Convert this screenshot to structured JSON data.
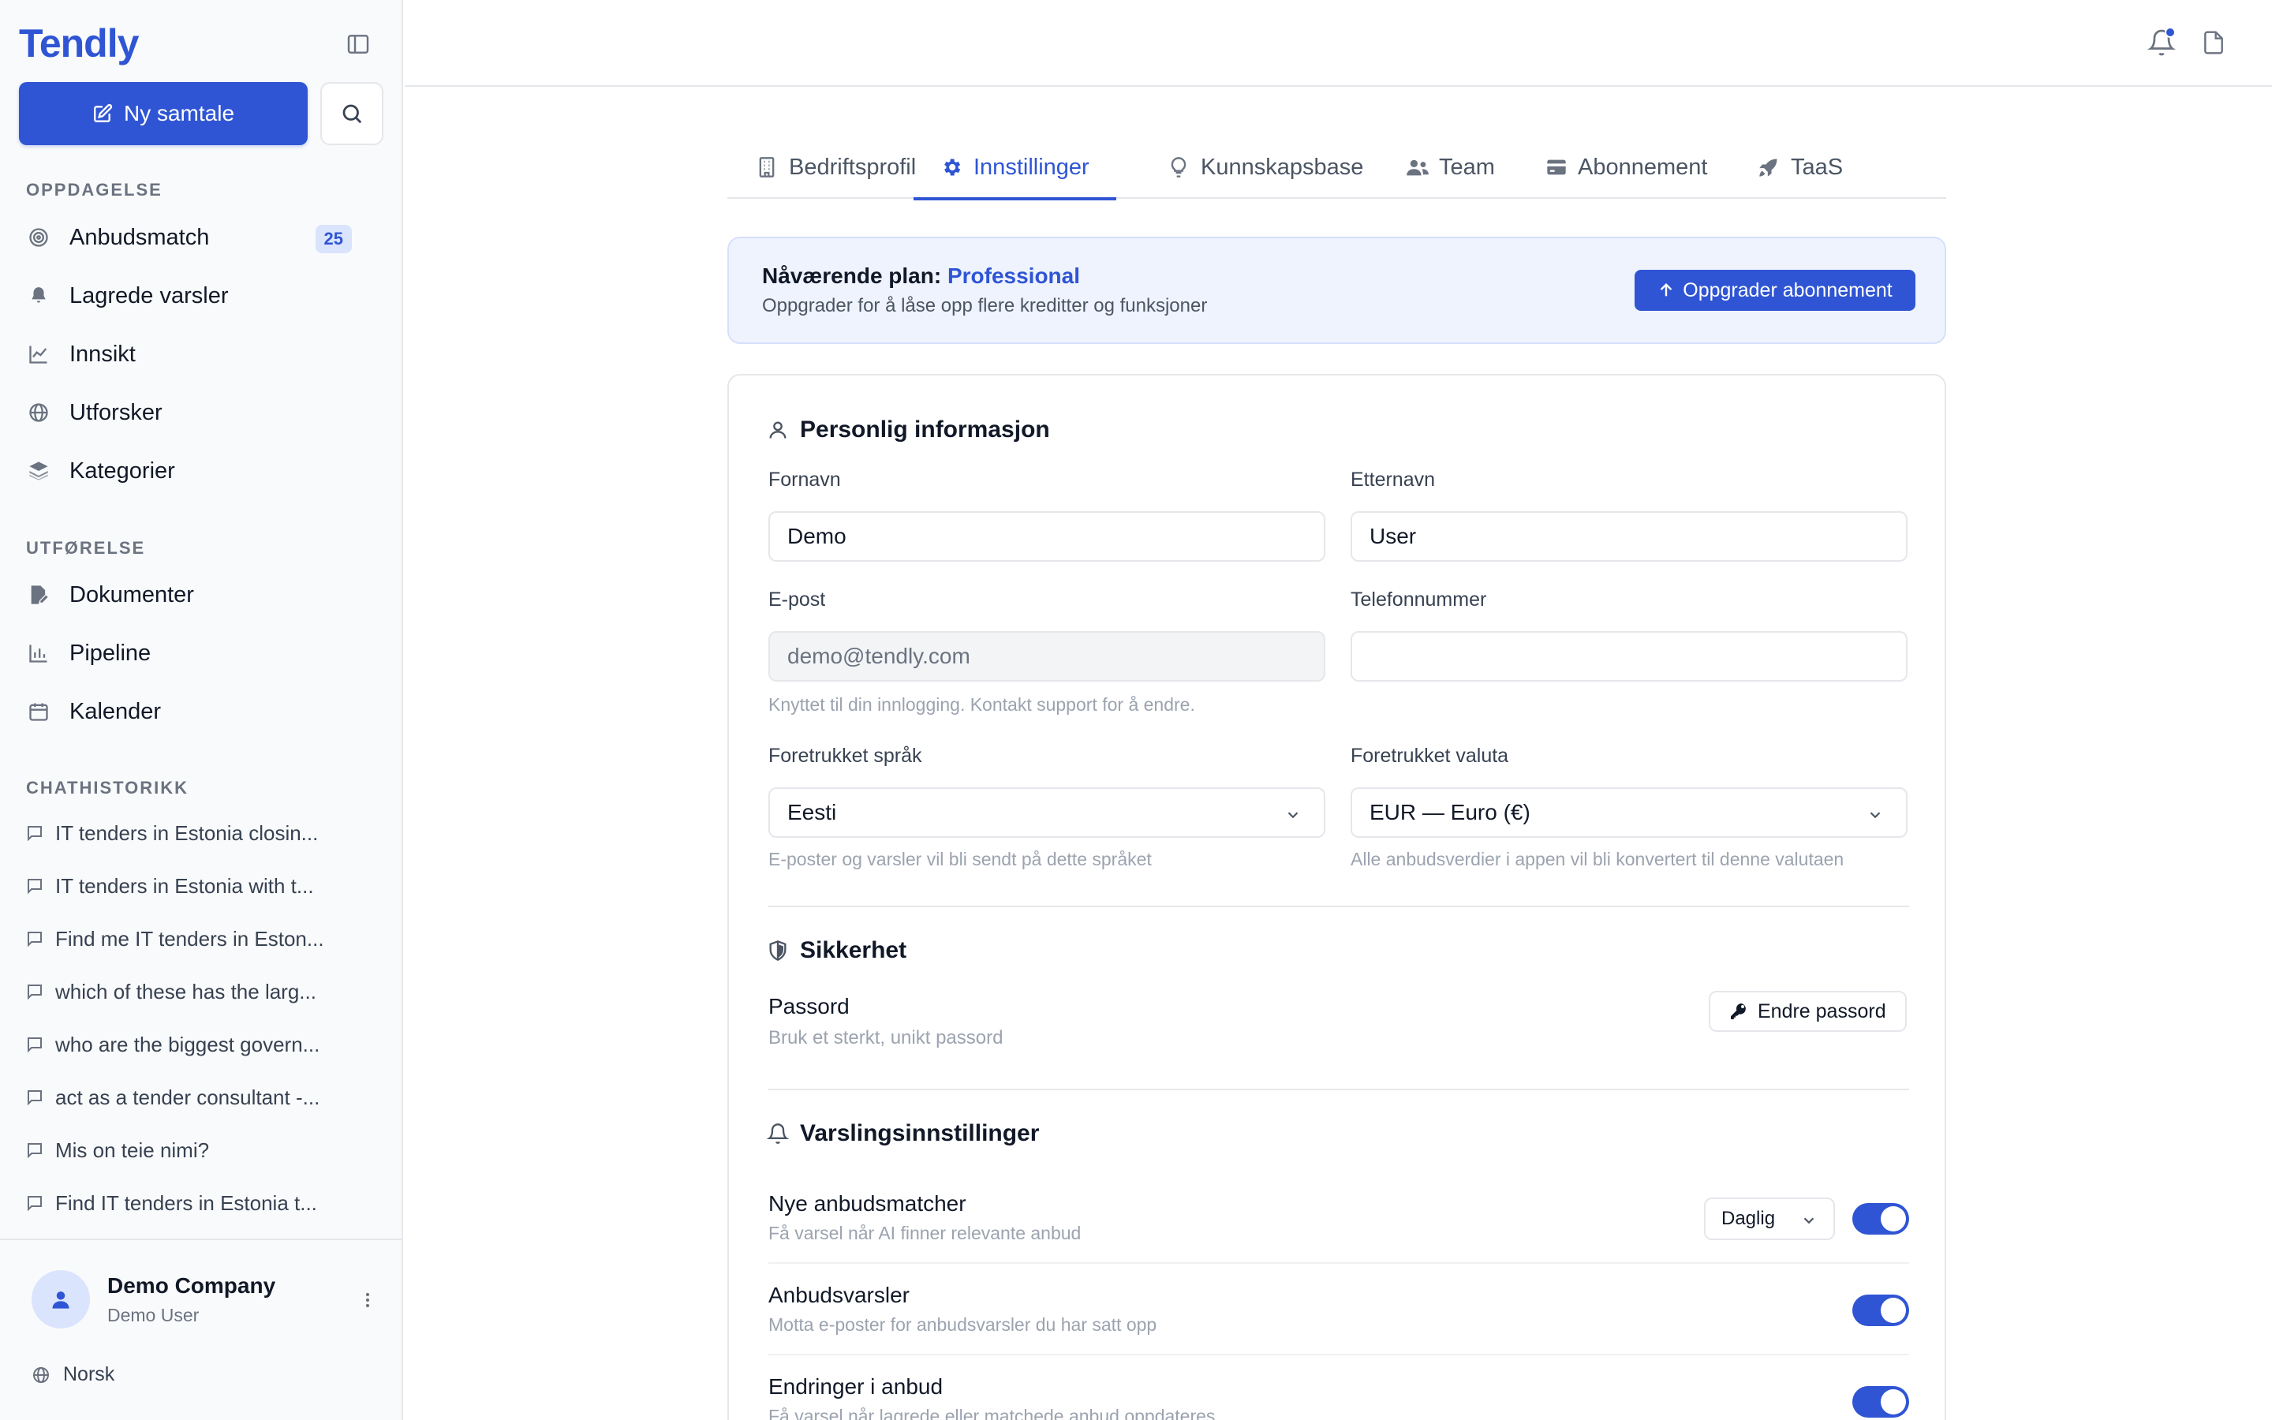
{
  "sidebar": {
    "logo": "Tendly",
    "new_chat_label": "Ny samtale",
    "sections": {
      "discovery": "OPPDAGELSE",
      "execution": "UTFØRELSE",
      "chat_history": "CHATHISTORIKK"
    },
    "discovery_items": [
      {
        "label": "Anbudsmatch",
        "icon": "target-icon",
        "badge": "25"
      },
      {
        "label": "Lagrede varsler",
        "icon": "bell-icon"
      },
      {
        "label": "Innsikt",
        "icon": "line-chart-icon"
      },
      {
        "label": "Utforsker",
        "icon": "globe-icon"
      },
      {
        "label": "Kategorier",
        "icon": "layers-icon"
      }
    ],
    "execution_items": [
      {
        "label": "Dokumenter",
        "icon": "file-edit-icon"
      },
      {
        "label": "Pipeline",
        "icon": "bar-chart-icon"
      },
      {
        "label": "Kalender",
        "icon": "calendar-icon"
      }
    ],
    "chats": [
      "IT tenders in Estonia closin...",
      "IT tenders in Estonia with t...",
      "Find me IT tenders in Eston...",
      "which of these has the larg...",
      "who are the biggest govern...",
      "act as a tender consultant -...",
      "Mis on teie nimi?",
      "Find IT tenders in Estonia t..."
    ],
    "footer": {
      "company": "Demo Company",
      "user": "Demo User",
      "language": "Norsk"
    }
  },
  "tabs": [
    {
      "label": "Bedriftsprofil",
      "icon": "building-icon"
    },
    {
      "label": "Innstillinger",
      "icon": "gear-icon",
      "active": true
    },
    {
      "label": "Kunnskapsbase",
      "icon": "lightbulb-icon"
    },
    {
      "label": "Team",
      "icon": "users-icon"
    },
    {
      "label": "Abonnement",
      "icon": "credit-card-icon"
    },
    {
      "label": "TaaS",
      "icon": "rocket-icon"
    }
  ],
  "plan": {
    "title_prefix": "Nåværende plan: ",
    "plan_name": "Professional",
    "subtitle": "Oppgrader for å låse opp flere kreditter og funksjoner",
    "upgrade_label": "Oppgrader abonnement"
  },
  "personal": {
    "heading": "Personlig informasjon",
    "first_name_label": "Fornavn",
    "first_name_value": "Demo",
    "last_name_label": "Etternavn",
    "last_name_value": "User",
    "email_label": "E-post",
    "email_value": "demo@tendly.com",
    "email_help": "Knyttet til din innlogging. Kontakt support for å endre.",
    "phone_label": "Telefonnummer",
    "phone_value": "",
    "language_label": "Foretrukket språk",
    "language_value": "Eesti",
    "language_help": "E-poster og varsler vil bli sendt på dette språket",
    "currency_label": "Foretrukket valuta",
    "currency_value": "EUR — Euro (€)",
    "currency_help": "Alle anbudsverdier i appen vil bli konvertert til denne valutaen"
  },
  "security": {
    "heading": "Sikkerhet",
    "password_label": "Passord",
    "password_help": "Bruk et sterkt, unikt passord",
    "change_password_label": "Endre passord"
  },
  "notifications": {
    "heading": "Varslingsinnstillinger",
    "items": [
      {
        "title": "Nye anbudsmatcher",
        "subtitle": "Få varsel når AI finner relevante anbud",
        "frequency": "Daglig",
        "enabled": true
      },
      {
        "title": "Anbudsvarsler",
        "subtitle": "Motta e-poster for anbudsvarsler du har satt opp",
        "enabled": true
      },
      {
        "title": "Endringer i anbud",
        "subtitle": "Få varsel når lagrede eller matchede anbud oppdateres",
        "enabled": true
      }
    ]
  },
  "colors": {
    "accent": "#2f55d4",
    "sidebar_bg": "#f9fafb",
    "banner_bg": "#eef3fe"
  }
}
